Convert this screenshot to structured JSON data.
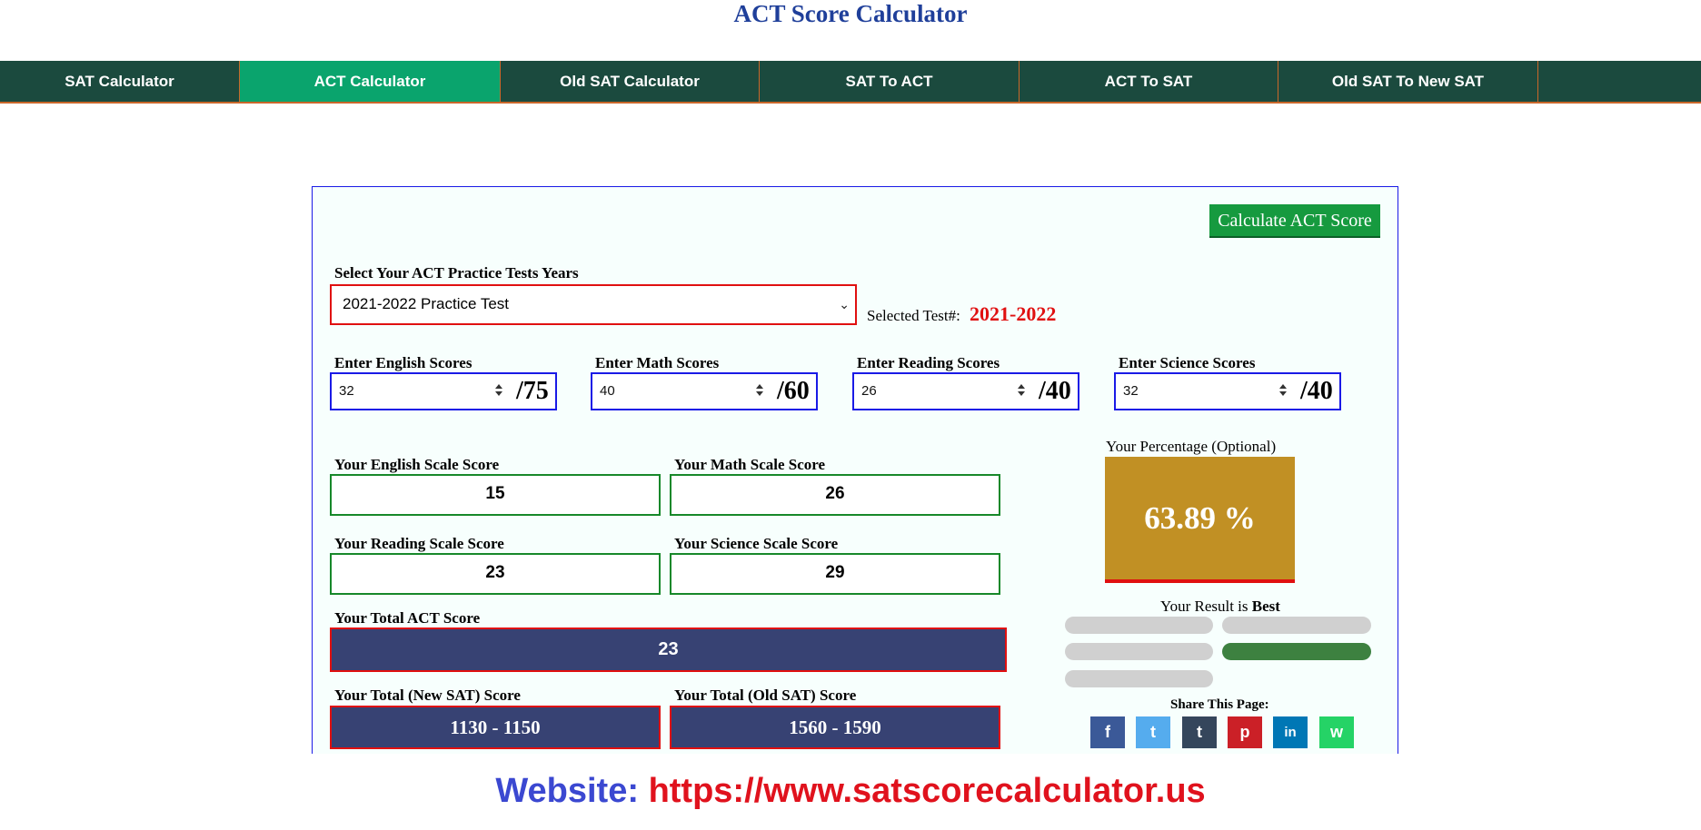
{
  "page_title": "ACT Score Calculator",
  "nav": {
    "items": [
      {
        "label": "SAT Calculator",
        "active": false
      },
      {
        "label": "ACT Calculator",
        "active": true
      },
      {
        "label": "Old SAT Calculator",
        "active": false
      },
      {
        "label": "SAT To ACT",
        "active": false
      },
      {
        "label": "ACT To SAT",
        "active": false
      },
      {
        "label": "Old SAT To New SAT",
        "active": false
      }
    ]
  },
  "calculator": {
    "calculate_button": "Calculate ACT Score",
    "test_select": {
      "label": "Select Your ACT Practice Tests Years",
      "value": "2021-2022 Practice Test"
    },
    "selected_test": {
      "label": "Selected Test#:",
      "value": "2021-2022"
    },
    "inputs": [
      {
        "label": "Enter English Scores",
        "value": "32",
        "max": "/75"
      },
      {
        "label": "Enter Math Scores",
        "value": "40",
        "max": "/60"
      },
      {
        "label": "Enter Reading Scores",
        "value": "26",
        "max": "/40"
      },
      {
        "label": "Enter Science Scores",
        "value": "32",
        "max": "/40"
      }
    ],
    "scale_scores": [
      {
        "label": "Your English Scale Score",
        "value": "15"
      },
      {
        "label": "Your Math Scale Score",
        "value": "26"
      },
      {
        "label": "Your Reading Scale Score",
        "value": "23"
      },
      {
        "label": "Your Science Scale Score",
        "value": "29"
      }
    ],
    "total_act": {
      "label": "Your Total ACT Score",
      "value": "23"
    },
    "new_sat": {
      "label": "Your Total (New SAT) Score",
      "value": "1130 - 1150"
    },
    "old_sat": {
      "label": "Your Total (Old SAT) Score",
      "value": "1560 - 1590"
    },
    "percentage": {
      "label": "Your Percentage (Optional)",
      "value": "63.89 %"
    },
    "result": {
      "prefix": "Your Result is",
      "value": "Best",
      "bar_level": 4,
      "bar_count": 5
    },
    "share": {
      "label": "Share This Page:",
      "icons": [
        {
          "name": "facebook-icon",
          "glyph": "f",
          "color": "#3b5998"
        },
        {
          "name": "twitter-icon",
          "glyph": "t",
          "color": "#55acee"
        },
        {
          "name": "tumblr-icon",
          "glyph": "t",
          "color": "#35465c"
        },
        {
          "name": "pinterest-icon",
          "glyph": "p",
          "color": "#cb2027"
        },
        {
          "name": "linkedin-icon",
          "glyph": "in",
          "color": "#0077b5"
        },
        {
          "name": "whatsapp-icon",
          "glyph": "w",
          "color": "#25d366"
        }
      ]
    }
  },
  "website": {
    "label": "Website:",
    "url": "https://www.satscorecalculator.us"
  }
}
